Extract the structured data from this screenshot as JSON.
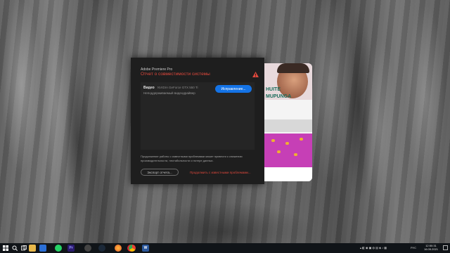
{
  "dialog": {
    "app_name": "Adobe Premiere Pro",
    "title": "Отчет о совместимости системы",
    "warning_icon": "warning-triangle-icon",
    "row": {
      "label": "Видео",
      "device": "NVIDIA GeForce GTX 550 Ti",
      "status": "Неподдерживаемый видеодрайвер"
    },
    "fix_button": "Исправление...",
    "notice": "Продолжение работы с известными проблемами может привести к снижению производительности, нестабильности и потере данных.",
    "export_button": "Экспорт отчета...",
    "continue_link": "Продолжить с известными проблемами...",
    "accent_color": "#e0483c",
    "button_color": "#1473e6"
  },
  "splash": {
    "text_top": "HUITE",
    "text_second": "MUPUNGA"
  },
  "taskbar": {
    "icons": [
      "windows-start-icon",
      "search-icon",
      "task-view-icon",
      "file-explorer-icon",
      "store-icon",
      "whatsapp-icon",
      "premiere-pro-icon",
      "obs-icon",
      "steam-icon",
      "firefox-icon",
      "opera-icon",
      "chrome-icon",
      "word-icon"
    ],
    "premiere_label": "Pr",
    "word_label": "W",
    "language": "РУС",
    "time": "12:50:31",
    "date": "16.05.2021"
  }
}
